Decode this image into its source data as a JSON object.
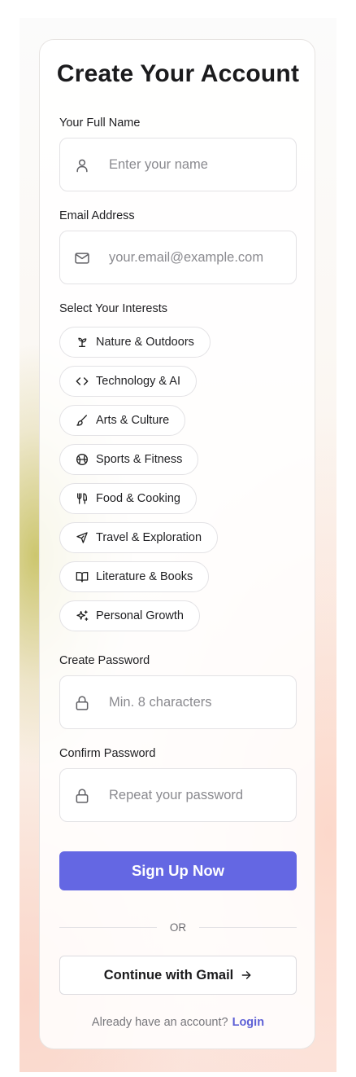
{
  "form": {
    "title": "Create Your Account",
    "name_label": "Your Full Name",
    "name_placeholder": "Enter your name",
    "email_label": "Email Address",
    "email_placeholder": "your.email@example.com",
    "interests_label": "Select Your Interests",
    "interests": [
      {
        "label": "Nature & Outdoors",
        "icon": "plant-icon"
      },
      {
        "label": "Technology & AI",
        "icon": "code-icon"
      },
      {
        "label": "Arts & Culture",
        "icon": "brush-icon"
      },
      {
        "label": "Sports & Fitness",
        "icon": "basketball-icon"
      },
      {
        "label": "Food & Cooking",
        "icon": "utensils-icon"
      },
      {
        "label": "Travel & Exploration",
        "icon": "plane-icon"
      },
      {
        "label": "Literature & Books",
        "icon": "book-icon"
      },
      {
        "label": "Personal Growth",
        "icon": "sparkles-icon"
      }
    ],
    "password_label": "Create Password",
    "password_placeholder": "Min. 8 characters",
    "confirm_label": "Confirm Password",
    "confirm_placeholder": "Repeat your password",
    "signup_label": "Sign Up Now",
    "divider_text": "OR",
    "gmail_label": "Continue with Gmail",
    "footer_text": "Already have an account?",
    "login_link": "Login"
  },
  "colors": {
    "accent": "#6467e3",
    "link": "#5d60d6",
    "text": "#1b1b1d",
    "placeholder": "#8a8a8f"
  }
}
